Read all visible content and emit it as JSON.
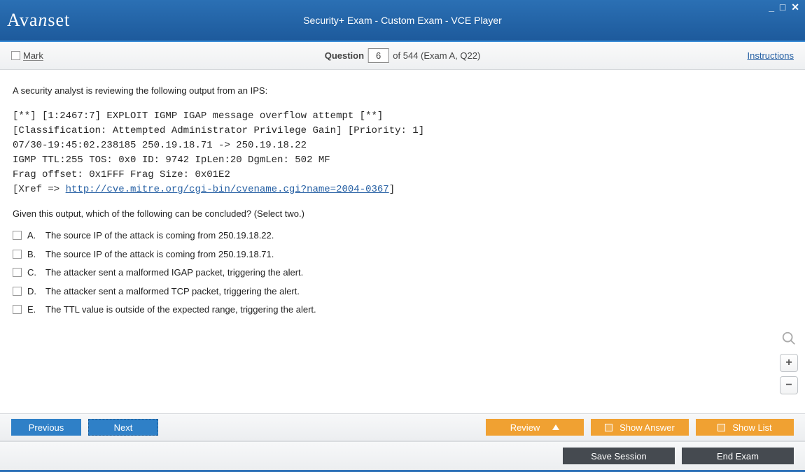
{
  "titlebar": {
    "title": "Security+ Exam - Custom Exam - VCE Player",
    "logo_prefix": "Ava",
    "logo_mid": "n",
    "logo_suffix": "set"
  },
  "subbar": {
    "mark_label": "Mark",
    "question_word": "Question",
    "question_number": "6",
    "question_suffix": "of 544 (Exam A, Q22)",
    "instructions_label": "Instructions"
  },
  "question": {
    "intro": "A security analyst is reviewing the following output from an IPS:",
    "output_line1": "[**] [1:2467:7] EXPLOIT IGMP IGAP message overflow attempt [**]",
    "output_line2": "[Classification: Attempted Administrator Privilege Gain] [Priority: 1]",
    "output_line3": "07/30-19:45:02.238185 250.19.18.71 -> 250.19.18.22",
    "output_line4": "IGMP TTL:255 TOS: 0x0 ID: 9742 IpLen:20 DgmLen: 502 MF",
    "output_line5": "Frag offset: 0x1FFF Frag Size: 0x01E2",
    "output_xref_open": "[Xref => ",
    "output_xref_url": "http://cve.mitre.org/cgi-bin/cvename.cgi?name=2004-0367",
    "output_xref_close": "]",
    "followup": "Given this output, which of the following can be concluded? (Select two.)",
    "answers": [
      {
        "letter": "A.",
        "text": "The source IP of the attack is coming from 250.19.18.22."
      },
      {
        "letter": "B.",
        "text": "The source IP of the attack is coming from 250.19.18.71."
      },
      {
        "letter": "C.",
        "text": "The attacker sent a malformed IGAP packet, triggering the alert."
      },
      {
        "letter": "D.",
        "text": "The attacker sent a malformed TCP packet, triggering the alert."
      },
      {
        "letter": "E.",
        "text": "The TTL value is outside of the expected range, triggering the alert."
      }
    ]
  },
  "buttons": {
    "previous": "Previous",
    "next": "Next",
    "review": "Review",
    "show_answer": "Show Answer",
    "show_list": "Show List",
    "save_session": "Save Session",
    "end_exam": "End Exam"
  },
  "zoom": {
    "plus": "+",
    "minus": "−"
  }
}
